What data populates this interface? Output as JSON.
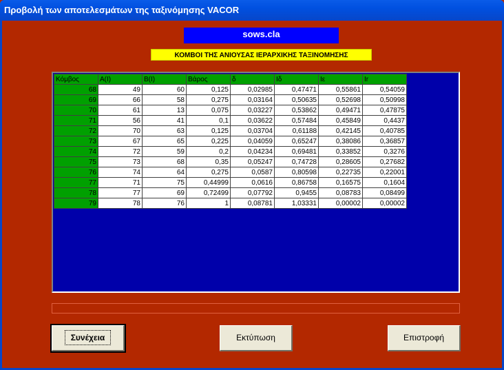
{
  "window": {
    "title": "Προβολή των αποτελεσμάτων της ταξινόμησης VACOR"
  },
  "header": {
    "filename": "sows.cla",
    "subtitle": "ΚΟΜΒΟΙ ΤΗΣ ΑΝΙΟΥΣΑΣ ΙΕΡΑΡΧΙΚΗΣ ΤΑΞΙΝΟΜΗΣΗΣ"
  },
  "table": {
    "columns": [
      "Κόμβος",
      "A(I)",
      "B(I)",
      "Βάρος",
      "δ",
      "Ιδ",
      "Ιε",
      "Ιr"
    ],
    "rows": [
      [
        "68",
        "49",
        "60",
        "0,125",
        "0,02985",
        "0,47471",
        "0,55861",
        "0,54059"
      ],
      [
        "69",
        "66",
        "58",
        "0,275",
        "0,03164",
        "0,50635",
        "0,52698",
        "0,50998"
      ],
      [
        "70",
        "61",
        "13",
        "0,075",
        "0,03227",
        "0,53862",
        "0,49471",
        "0,47875"
      ],
      [
        "71",
        "56",
        "41",
        "0,1",
        "0,03622",
        "0,57484",
        "0,45849",
        "0,4437"
      ],
      [
        "72",
        "70",
        "63",
        "0,125",
        "0,03704",
        "0,61188",
        "0,42145",
        "0,40785"
      ],
      [
        "73",
        "67",
        "65",
        "0,225",
        "0,04059",
        "0,65247",
        "0,38086",
        "0,36857"
      ],
      [
        "74",
        "72",
        "59",
        "0,2",
        "0,04234",
        "0,69481",
        "0,33852",
        "0,3276"
      ],
      [
        "75",
        "73",
        "68",
        "0,35",
        "0,05247",
        "0,74728",
        "0,28605",
        "0,27682"
      ],
      [
        "76",
        "74",
        "64",
        "0,275",
        "0,0587",
        "0,80598",
        "0,22735",
        "0,22001"
      ],
      [
        "77",
        "71",
        "75",
        "0,44999",
        "0,0616",
        "0,86758",
        "0,16575",
        "0,1604"
      ],
      [
        "78",
        "77",
        "69",
        "0,72499",
        "0,07792",
        "0,9455",
        "0,08783",
        "0,08499"
      ],
      [
        "79",
        "78",
        "76",
        "1",
        "0,08781",
        "1,03331",
        "0,00002",
        "0,00002"
      ]
    ]
  },
  "buttons": {
    "continue": "Συνέχεια",
    "print": "Εκτύπωση",
    "back": "Επιστροφή"
  },
  "colors": {
    "background": "#b32800",
    "grid_background": "#0000aa",
    "header_cell": "#00a000",
    "filename_bar": "#0000ff",
    "subtitle_bar": "#ffff00"
  }
}
